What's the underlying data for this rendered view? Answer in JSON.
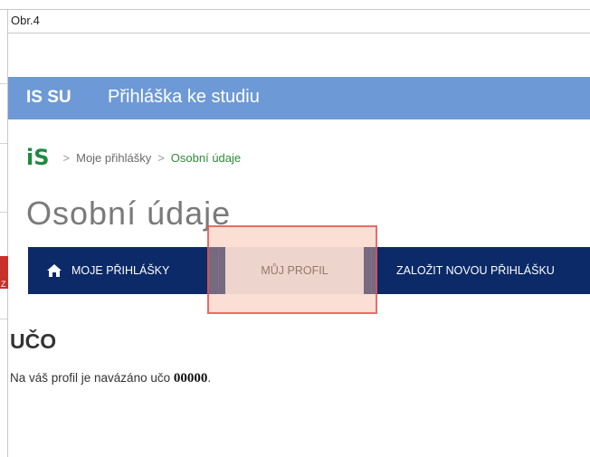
{
  "document": {
    "caption": "Obr.4",
    "side_tab_letter": "Z"
  },
  "header": {
    "brand": "IS SU",
    "title": "Přihláška ke studiu",
    "color": "#6d9ad6"
  },
  "breadcrumb": {
    "logo": "iS",
    "items": [
      "Moje přihlášky",
      "Osobní údaje"
    ]
  },
  "page": {
    "title": "Osobní údaje"
  },
  "nav": {
    "color": "#0b2a67",
    "items": [
      {
        "label": "MOJE PŘIHLÁŠKY",
        "icon": "home-icon"
      },
      {
        "label": "MŮJ PROFIL",
        "active": true
      },
      {
        "label": "ZALOŽIT NOVOU PŘIHLÁŠKU"
      }
    ]
  },
  "uco": {
    "heading": "UČO",
    "text_prefix": "Na váš profil je navázáno učo ",
    "value": "00000",
    "text_suffix": "."
  },
  "highlight": {
    "target": "MŮJ PROFIL",
    "color": "#e74c4c"
  }
}
